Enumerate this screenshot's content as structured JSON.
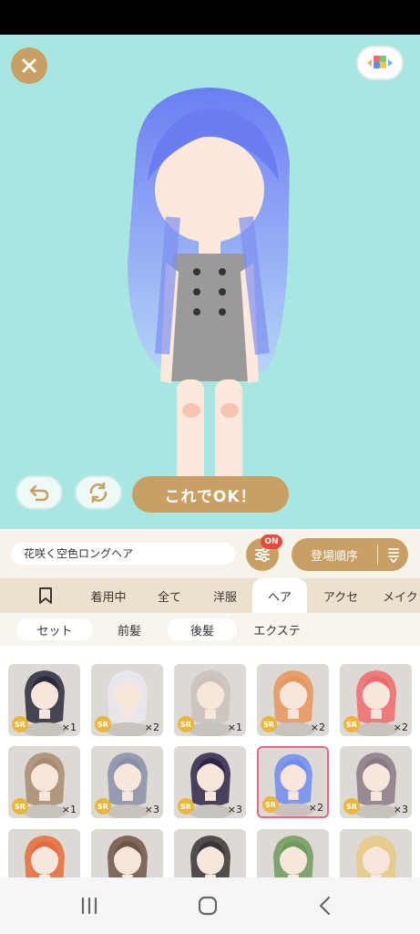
{
  "name_row": {
    "item_name": "花咲く空色ロングヘア",
    "filter_badge": "ON",
    "sort_label": "登場順序"
  },
  "stage": {
    "ok_label": "これでOK！"
  },
  "category_tabs": [
    "着用中",
    "全て",
    "洋服",
    "ヘア",
    "アクセ",
    "メイク"
  ],
  "active_category": "ヘア",
  "sub_tabs": [
    "セット",
    "前髪",
    "後髪",
    "エクステ"
  ],
  "active_sub_tab": "前髪",
  "items": [
    {
      "rarity": "SR",
      "count": "×1",
      "hair": "#2a2a3a"
    },
    {
      "rarity": "SR",
      "count": "×2",
      "hair": "#e8e8ee"
    },
    {
      "rarity": "SR",
      "count": "×1",
      "hair": "#c9c2bb"
    },
    {
      "rarity": "SR",
      "count": "×2",
      "hair": "#e8955a"
    },
    {
      "rarity": "SR",
      "count": "×2",
      "hair": "#ee6b6b"
    },
    {
      "rarity": "SR",
      "count": "×1",
      "hair": "#a88b70"
    },
    {
      "rarity": "SR",
      "count": "×3",
      "hair": "#8a8fa8"
    },
    {
      "rarity": "SR",
      "count": "×3",
      "hair": "#2e2448"
    },
    {
      "rarity": "SR",
      "count": "×2",
      "hair": "#6f8cf0"
    },
    {
      "rarity": "SR",
      "count": "×3",
      "hair": "#8b7a86"
    },
    {
      "rarity": "",
      "count": "",
      "hair": "#e66a3a"
    },
    {
      "rarity": "",
      "count": "",
      "hair": "#6e5546"
    },
    {
      "rarity": "",
      "count": "",
      "hair": "#3a3434"
    },
    {
      "rarity": "",
      "count": "",
      "hair": "#6f9a5c"
    },
    {
      "rarity": "",
      "count": "",
      "hair": "#e9c986"
    }
  ],
  "selected_item": 8,
  "colors": {
    "accent": "#c8a064",
    "stage_bg": "#a8e6e2",
    "badge_red": "#e84a3c",
    "selected_border": "#e66a86",
    "rarity_gold": "#e9b73e"
  },
  "icons": {
    "close": "close-icon",
    "menu": "color-blocks-icon",
    "undo": "undo-icon",
    "rotate": "rotate-icon",
    "filter": "sliders-icon",
    "sort": "sort-order-icon",
    "bookmark": "bookmark-icon",
    "nav_recent": "recent-apps-icon",
    "nav_home": "home-icon",
    "nav_back": "back-icon"
  }
}
